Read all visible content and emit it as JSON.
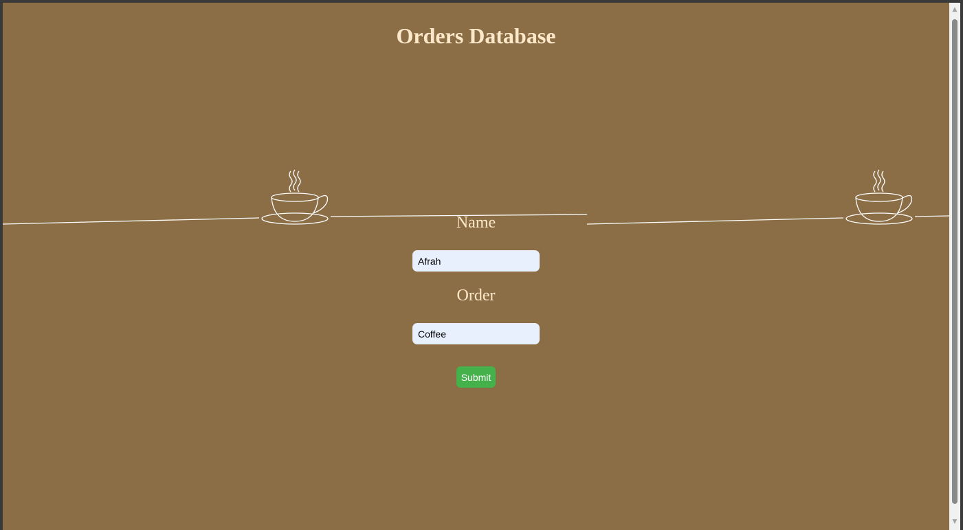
{
  "page": {
    "title": "Orders Database"
  },
  "form": {
    "name_label": "Name",
    "name_value": "Afrah",
    "order_label": "Order",
    "order_value": "Coffee",
    "submit_label": "Submit"
  },
  "colors": {
    "background": "#8b6d46",
    "text": "#fde9c9",
    "input_bg": "#e8f0fe",
    "submit_bg": "#45b14b"
  },
  "icons": {
    "decor": "coffee-cup-icon",
    "scroll_up": "chevron-up-icon",
    "scroll_down": "chevron-down-icon"
  }
}
